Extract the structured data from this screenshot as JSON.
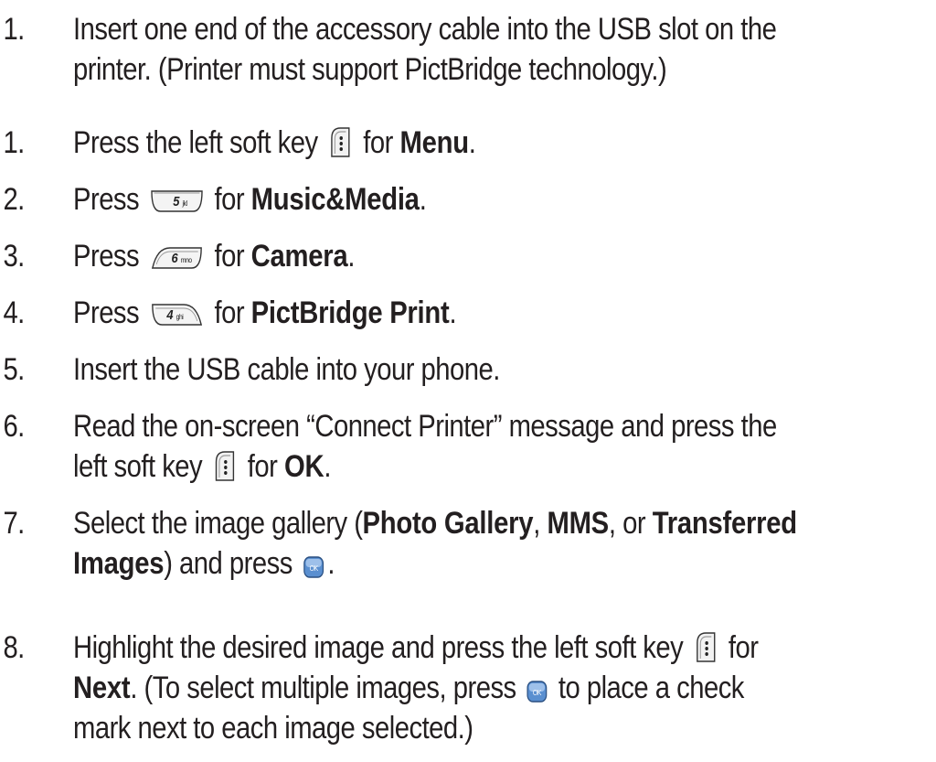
{
  "steps": [
    {
      "number": "1.",
      "line1": "Insert one end of the accessory cable into the USB slot on the",
      "line2": "printer. (Printer must support PictBridge technology.)"
    },
    {
      "number": "1.",
      "pre": "Press the left soft key",
      "key_icon": "left-soft-key-icon",
      "mid": "for",
      "bold": "Menu",
      "post": "."
    },
    {
      "number": "2.",
      "pre": "Press",
      "key_icon": "5-jkl-key-icon",
      "key_label": "5",
      "key_sub": "jkl",
      "mid": "for",
      "bold": "Music&Media",
      "post": "."
    },
    {
      "number": "3.",
      "pre": "Press",
      "key_icon": "6-mno-key-icon",
      "key_label": "6",
      "key_sub": "mno",
      "mid": "for",
      "bold": "Camera",
      "post": "."
    },
    {
      "number": "4.",
      "pre": "Press",
      "key_icon": "4-ghi-key-icon",
      "key_label": "4",
      "key_sub": "ghi",
      "mid": "for",
      "bold": "PictBridge Print",
      "post": "."
    },
    {
      "number": "5.",
      "text": "Insert the USB cable into your phone."
    },
    {
      "number": "6.",
      "line1": "Read the on-screen “Connect Printer” message and press the",
      "line2_pre": "left soft key",
      "key_icon": "left-soft-key-icon",
      "line2_mid": "for",
      "line2_bold": "OK",
      "line2_post": "."
    },
    {
      "number": "7.",
      "line1_pre": "Select the image gallery (",
      "line1_bold1": "Photo Gallery",
      "line1_sep1": ",",
      "line1_bold2": "MMS",
      "line1_sep2": ", or",
      "line1_bold3": "Transferred",
      "line2_bold": "Images",
      "line2_post": ") and press",
      "ok_key_label": "OK",
      "line2_end": "."
    },
    {
      "number": "8.",
      "line1_pre": "Highlight the desired image and press the left soft key",
      "line1_post": "for",
      "line2_bold": "Next",
      "line2_mid": ". (To select multiple images, press",
      "ok_key_label": "OK",
      "line2_post": "to place a check",
      "line3": "mark next to each image selected.)"
    }
  ]
}
